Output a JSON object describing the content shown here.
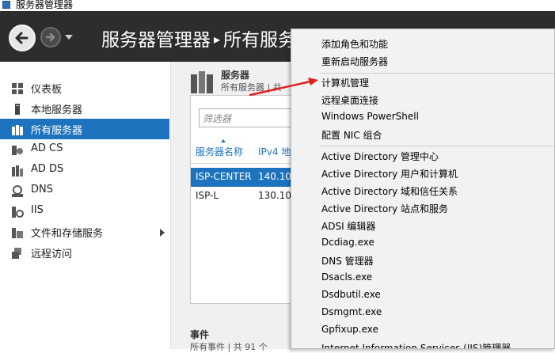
{
  "window": {
    "title": "服务器管理器"
  },
  "header": {
    "breadcrumb_root": "服务器管理器",
    "breadcrumb_sep": "▸",
    "breadcrumb_current": "所有服务器"
  },
  "sidebar": {
    "items": [
      {
        "label": "仪表板",
        "icon": "dashboard-icon"
      },
      {
        "label": "本地服务器",
        "icon": "server-icon"
      },
      {
        "label": "所有服务器",
        "icon": "servers-icon",
        "active": true
      },
      {
        "label": "AD CS",
        "icon": "adcs-icon"
      },
      {
        "label": "AD DS",
        "icon": "adds-icon"
      },
      {
        "label": "DNS",
        "icon": "dns-icon"
      },
      {
        "label": "IIS",
        "icon": "iis-icon"
      },
      {
        "label": "文件和存储服务",
        "icon": "file-storage-icon",
        "has_submenu": true
      },
      {
        "label": "远程访问",
        "icon": "remote-access-icon"
      }
    ]
  },
  "main": {
    "tile_title": "服务器",
    "tile_subtitle": "所有服务器 | 共",
    "filter_placeholder": "筛选器",
    "columns": [
      "服务器名称",
      "IPv4 地"
    ],
    "rows": [
      {
        "name": "ISP-CENTER",
        "ipv4": "140.10.",
        "selected": true
      },
      {
        "name": "ISP-L",
        "ipv4": "130.10."
      }
    ],
    "events_title": "事件",
    "events_subtitle": "所有事件 | 共 91 个"
  },
  "context_menu": {
    "groups": [
      [
        "添加角色和功能",
        "重新启动服务器"
      ],
      [
        "计算机管理",
        "远程桌面连接",
        "Windows PowerShell",
        "配置 NIC 组合"
      ],
      [
        "Active Directory 管理中心",
        "Active Directory 用户和计算机",
        "Active Directory 域和信任关系",
        "Active Directory 站点和服务",
        "ADSI 编辑器",
        "Dcdiag.exe",
        "DNS 管理器",
        "Dsacls.exe",
        "Dsdbutil.exe",
        "Dsmgmt.exe",
        "Gpfixup.exe",
        "Internet Information Services (IIS)管理器"
      ]
    ],
    "highlighted_item": "计算机管理"
  },
  "colors": {
    "header_bg": "#2d2d2d",
    "accent": "#1e73be",
    "annotation_arrow": "#e02020",
    "menu_bg": "#f2f2f2"
  }
}
